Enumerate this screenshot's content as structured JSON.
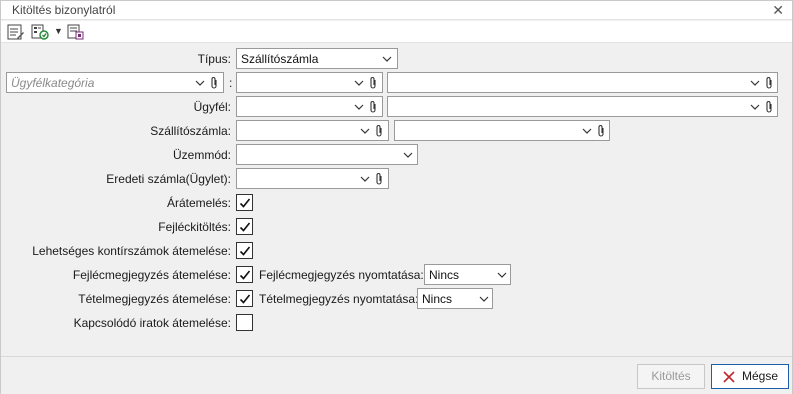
{
  "window": {
    "title": "Kitöltés bizonylatról",
    "close_glyph": "✕"
  },
  "toolbar": {
    "icons": [
      "form-fill-icon",
      "list-refresh-icon",
      "dropdown-arrow-icon",
      "template-icon"
    ],
    "dropdown_glyph": "▼"
  },
  "form": {
    "tipus": {
      "label": "Típus:",
      "value": "Szállítószámla"
    },
    "ugyfelkategoria": {
      "placeholder": "Ügyfélkategória",
      "separator": ":",
      "value1": "",
      "value2": ""
    },
    "ugyfel": {
      "label": "Ügyfél:",
      "value1": "",
      "value2": ""
    },
    "szallitoszamla": {
      "label": "Szállítószámla:",
      "value1": "",
      "value2": ""
    },
    "uzemmod": {
      "label": "Üzemmód:",
      "value": ""
    },
    "eredeti_szamla": {
      "label": "Eredeti számla(Ügylet):",
      "value": ""
    },
    "aratemeles": {
      "label": "Árátemelés:",
      "checked": true
    },
    "fejlectoltes": {
      "label": "Fejléckitöltés:",
      "checked": true
    },
    "kontirszamok": {
      "label": "Lehetséges kontírszámok átemelése:",
      "checked": true
    },
    "fejlecmegjegyzes": {
      "label": "Fejlécmegjegyzés átemelése:",
      "checked": true,
      "print_label": "Fejlécmegjegyzés nyomtatása:",
      "print_value": "Nincs"
    },
    "tetelmegjegyzes": {
      "label": "Tételmegjegyzés átemelése:",
      "checked": true,
      "print_label": "Tételmegjegyzés nyomtatása:",
      "print_value": "Nincs"
    },
    "kapcsolodo": {
      "label": "Kapcsolódó iratok átemelése:",
      "checked": false
    }
  },
  "footer": {
    "fill_label": "Kitöltés",
    "cancel_label": "Mégse"
  },
  "colors": {
    "accent": "#1c5fa8",
    "cancel_x": "#c0282b",
    "disabled_text": "#9a9a9a"
  }
}
